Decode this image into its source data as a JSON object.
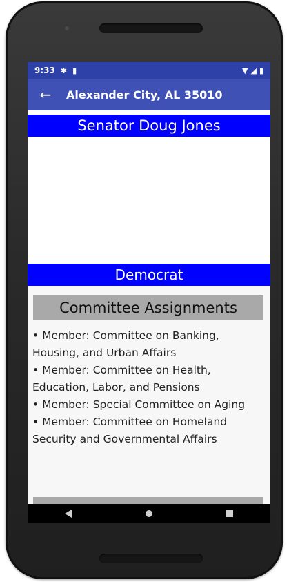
{
  "status_bar": {
    "time": "9:33",
    "icons": [
      "gear-icon",
      "sd-card-icon",
      "wifi-icon",
      "signal-icon",
      "battery-icon"
    ]
  },
  "app_bar": {
    "back_icon": "arrow-left-icon",
    "title": "Alexander City, AL 35010"
  },
  "senator": {
    "name": "Senator Doug Jones",
    "party": "Democrat"
  },
  "committees": {
    "heading": "Committee Assignments",
    "items": [
      "• Member: Committee on Banking, Housing, and Urban Affairs",
      "• Member: Committee on Health, Education, Labor, and Pensions",
      "• Member: Special Committee on Aging",
      "• Member: Committee on Homeland Security and Governmental Affairs"
    ]
  },
  "nav_bar": {
    "icons": [
      "nav-back-icon",
      "nav-home-icon",
      "nav-recents-icon"
    ]
  },
  "colors": {
    "status_bar": "#2d41a8",
    "app_bar": "#3f51b5",
    "banner": "#0000ff",
    "section_header": "#a9a9a9"
  }
}
